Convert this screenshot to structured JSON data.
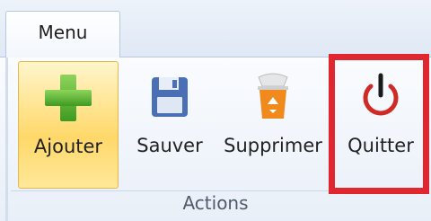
{
  "ribbon": {
    "tab_label": "Menu",
    "group_label": "Actions",
    "buttons": [
      {
        "label": "Ajouter",
        "icon": "plus-icon",
        "state": "highlighted"
      },
      {
        "label": "Sauver",
        "icon": "floppy-disk-icon"
      },
      {
        "label": "Supprimer",
        "icon": "recycle-bin-icon"
      },
      {
        "label": "Quitter",
        "icon": "power-icon",
        "annotation": "red-outline"
      }
    ]
  },
  "colors": {
    "plus": "#5cb335",
    "floppy": "#4a6fb5",
    "recycle": "#f08a1c",
    "power": "#d02a26",
    "annotation": "#e0262e",
    "hover": "#ffd86a"
  }
}
